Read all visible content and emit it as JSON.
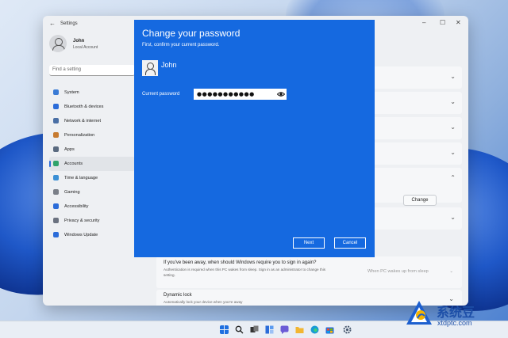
{
  "window": {
    "title": "Settings",
    "user": {
      "name": "John",
      "account": "Local Account"
    },
    "search_placeholder": "Find a setting",
    "nav": [
      {
        "label": "System",
        "icon": "system-icon",
        "color": "#3a7bd5"
      },
      {
        "label": "Bluetooth & devices",
        "icon": "bluetooth-icon",
        "color": "#2b6cd9"
      },
      {
        "label": "Network & internet",
        "icon": "wifi-icon",
        "color": "#4a6fa5"
      },
      {
        "label": "Personalization",
        "icon": "brush-icon",
        "color": "#c77b30"
      },
      {
        "label": "Apps",
        "icon": "apps-icon",
        "color": "#5a6a80"
      },
      {
        "label": "Accounts",
        "icon": "person-icon",
        "color": "#2fa36b",
        "active": true
      },
      {
        "label": "Time & language",
        "icon": "globe-icon",
        "color": "#3a8fd5"
      },
      {
        "label": "Gaming",
        "icon": "controller-icon",
        "color": "#7a7f88"
      },
      {
        "label": "Accessibility",
        "icon": "accessibility-icon",
        "color": "#2b6cd9"
      },
      {
        "label": "Privacy & security",
        "icon": "shield-icon",
        "color": "#6b7280"
      },
      {
        "label": "Windows Update",
        "icon": "update-icon",
        "color": "#2b6cd9"
      }
    ],
    "change_label": "Change",
    "away": {
      "question": "If you've been away, when should Windows require you to sign in again?",
      "desc_line1": "Authentication is required when this PC wakes from sleep. Sign in as an administrator to change this",
      "desc_line2": "setting.",
      "selected": "When PC wakes up from sleep"
    },
    "dynamic_lock": {
      "title": "Dynamic lock",
      "desc": "Automatically lock your device when you're away"
    }
  },
  "dialog": {
    "title": "Change your password",
    "subtitle": "First, confirm your current password.",
    "user": "John",
    "password_label": "Current password",
    "password_value": "●●●●●●●●●●●",
    "next_label": "Next",
    "cancel_label": "Cancel",
    "color": "#1569e0"
  },
  "taskbar": {
    "icons": [
      "start-icon",
      "search-icon",
      "task-view-icon",
      "widgets-icon",
      "chat-icon",
      "file-explorer-icon",
      "edge-icon",
      "store-icon",
      "settings-icon"
    ]
  },
  "watermark": {
    "name": "系统豆",
    "url": "xtdptc.com"
  }
}
